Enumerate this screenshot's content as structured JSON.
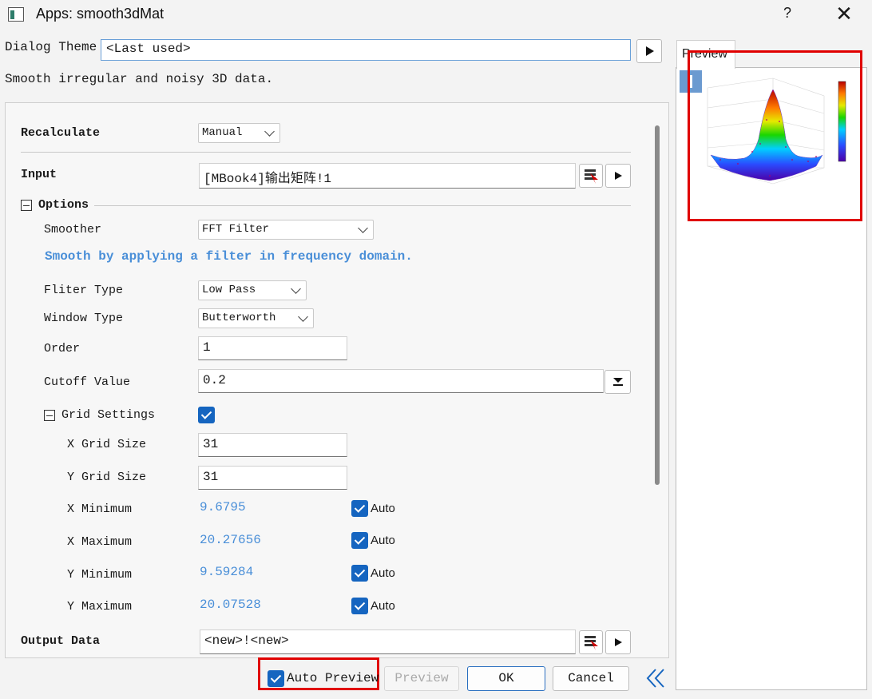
{
  "window": {
    "title": "Apps: smooth3dMat",
    "help": "?",
    "close": "✕"
  },
  "theme": {
    "label": "Dialog Theme",
    "value": "<Last used>"
  },
  "description": "Smooth irregular and noisy 3D data.",
  "form": {
    "recalculate": {
      "label": "Recalculate",
      "value": "Manual"
    },
    "input": {
      "label": "Input",
      "value": "[MBook4]输出矩阵!1"
    },
    "options": {
      "label": "Options",
      "smoother": {
        "label": "Smoother",
        "value": "FFT Filter"
      },
      "hint": "Smooth by applying a filter in frequency domain.",
      "filter_type": {
        "label": "Fliter Type",
        "value": "Low Pass"
      },
      "window_type": {
        "label": "Window Type",
        "value": "Butterworth"
      },
      "order": {
        "label": "Order",
        "value": "1"
      },
      "cutoff": {
        "label": "Cutoff Value",
        "value": "0.2"
      },
      "grid_settings": {
        "label": "Grid Settings",
        "checked": true,
        "x_grid_size": {
          "label": "X Grid Size",
          "value": "31"
        },
        "y_grid_size": {
          "label": "Y Grid Size",
          "value": "31"
        },
        "x_min": {
          "label": "X Minimum",
          "value": "9.6795",
          "auto": "Auto"
        },
        "x_max": {
          "label": "X Maximum",
          "value": "20.27656",
          "auto": "Auto"
        },
        "y_min": {
          "label": "Y Minimum",
          "value": "9.59284",
          "auto": "Auto"
        },
        "y_max": {
          "label": "Y Maximum",
          "value": "20.07528",
          "auto": "Auto"
        }
      }
    },
    "output": {
      "label": "Output Data",
      "value": "<new>!<new>"
    }
  },
  "buttons": {
    "auto_preview": "Auto Preview",
    "auto_preview_checked": true,
    "preview": "Preview",
    "ok": "OK",
    "cancel": "Cancel"
  },
  "preview_pane": {
    "tab": "Preview"
  },
  "colors": {
    "accent": "#1565c0",
    "hint_blue": "#4a8fd8",
    "highlight_red": "#e00000"
  }
}
